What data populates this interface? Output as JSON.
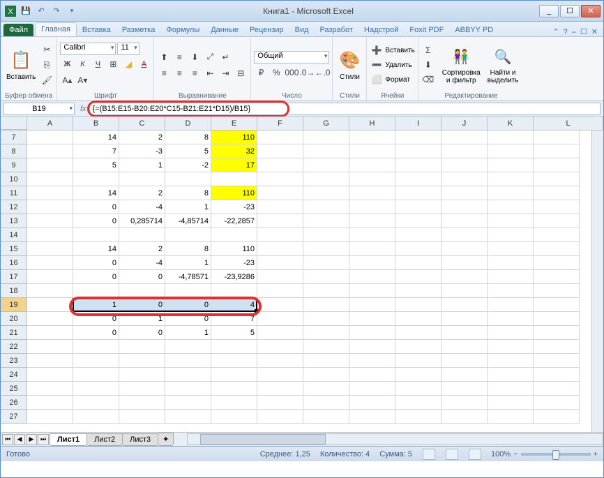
{
  "window": {
    "title": "Книга1 - Microsoft Excel"
  },
  "tabs": {
    "file": "Файл",
    "home": "Главная",
    "insert": "Вставка",
    "layout": "Разметка",
    "formulas": "Формулы",
    "data": "Данные",
    "review": "Рецензир",
    "view": "Вид",
    "developer": "Разработ",
    "addins": "Надстрой",
    "foxit": "Foxit PDF",
    "abbyy": "ABBYY PD"
  },
  "ribbon": {
    "clipboard": {
      "paste": "Вставить",
      "label": "Буфер обмена"
    },
    "font": {
      "name": "Calibri",
      "size": "11",
      "label": "Шрифт"
    },
    "align": {
      "label": "Выравнивание"
    },
    "number": {
      "format": "Общий",
      "label": "Число"
    },
    "styles": {
      "label": "Стили",
      "btn": "Стили"
    },
    "cells": {
      "insert": "Вставить",
      "delete": "Удалить",
      "format": "Формат",
      "label": "Ячейки"
    },
    "editing": {
      "sort": "Сортировка\nи фильтр",
      "find": "Найти и\nвыделить",
      "label": "Редактирование"
    }
  },
  "namebox": "B19",
  "formula": "{=(B15:E15-B20:E20*C15-B21:E21*D15)/B15}",
  "cols": [
    "A",
    "B",
    "C",
    "D",
    "E",
    "F",
    "G",
    "H",
    "I",
    "J",
    "K",
    "L"
  ],
  "rows": [
    {
      "n": 7,
      "c": {
        "B": "14",
        "C": "2",
        "D": "8",
        "E": "110"
      },
      "y": [
        "E"
      ]
    },
    {
      "n": 8,
      "c": {
        "B": "7",
        "C": "-3",
        "D": "5",
        "E": "32"
      },
      "y": [
        "E"
      ]
    },
    {
      "n": 9,
      "c": {
        "B": "5",
        "C": "1",
        "D": "-2",
        "E": "17"
      },
      "y": [
        "E"
      ]
    },
    {
      "n": 10,
      "c": {}
    },
    {
      "n": 11,
      "c": {
        "B": "14",
        "C": "2",
        "D": "8",
        "E": "110"
      },
      "y": [
        "E"
      ]
    },
    {
      "n": 12,
      "c": {
        "B": "0",
        "C": "-4",
        "D": "1",
        "E": "-23"
      }
    },
    {
      "n": 13,
      "c": {
        "B": "0",
        "C": "0,285714",
        "D": "-4,85714",
        "E": "-22,2857"
      }
    },
    {
      "n": 14,
      "c": {}
    },
    {
      "n": 15,
      "c": {
        "B": "14",
        "C": "2",
        "D": "8",
        "E": "110"
      }
    },
    {
      "n": 16,
      "c": {
        "B": "0",
        "C": "-4",
        "D": "1",
        "E": "-23"
      }
    },
    {
      "n": 17,
      "c": {
        "B": "0",
        "C": "0",
        "D": "-4,78571",
        "E": "-23,9286"
      }
    },
    {
      "n": 18,
      "c": {}
    },
    {
      "n": 19,
      "c": {
        "B": "1",
        "C": "0",
        "D": "0",
        "E": "4"
      },
      "sel": true
    },
    {
      "n": 20,
      "c": {
        "B": "0",
        "C": "1",
        "D": "0",
        "E": "7"
      }
    },
    {
      "n": 21,
      "c": {
        "B": "0",
        "C": "0",
        "D": "1",
        "E": "5"
      }
    },
    {
      "n": 22,
      "c": {}
    },
    {
      "n": 23,
      "c": {}
    },
    {
      "n": 24,
      "c": {}
    },
    {
      "n": 25,
      "c": {}
    },
    {
      "n": 26,
      "c": {}
    },
    {
      "n": 27,
      "c": {}
    }
  ],
  "sheets": {
    "s1": "Лист1",
    "s2": "Лист2",
    "s3": "Лист3"
  },
  "status": {
    "ready": "Готово",
    "avg": "Среднее: 1,25",
    "count": "Количество: 4",
    "sum": "Сумма: 5",
    "zoom": "100%"
  }
}
